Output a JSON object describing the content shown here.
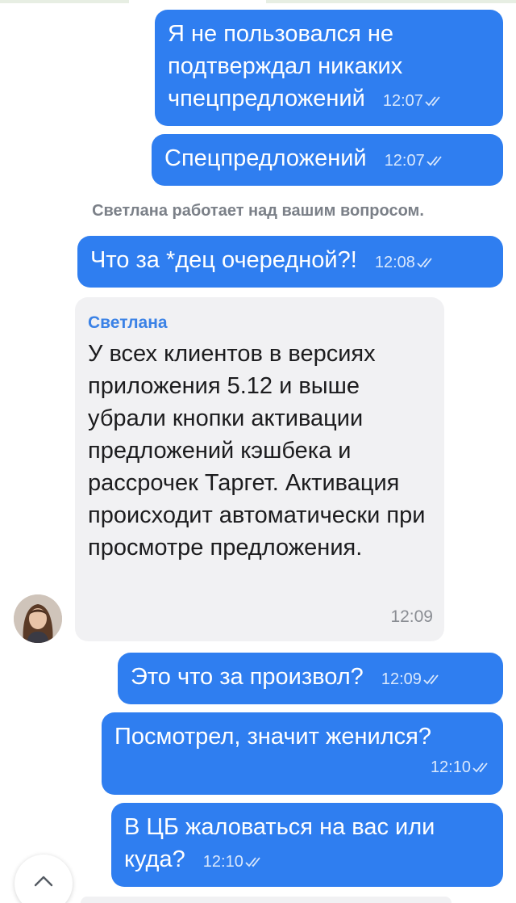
{
  "messages": [
    {
      "text": "Я не пользовался не подтверждал никаких чпецпредложений",
      "time": "12:07"
    },
    {
      "text": "Спецпредложений",
      "time": "12:07"
    },
    {
      "text": "Что за *дец очередной?!",
      "time": "12:08"
    },
    {
      "sender": "Светлана",
      "text": "У всех клиентов в версиях приложения 5.12 и выше убрали кнопки активации предложений кэшбека и рассрочек Таргет. Активация происходит автоматически при просмотре предложения.",
      "time": "12:09"
    },
    {
      "text": "Это что за произвол?",
      "time": "12:09"
    },
    {
      "text": "Посмотрел, значит женился?",
      "time": "12:10"
    },
    {
      "text": "В ЦБ жаловаться на вас или куда?",
      "time": "12:10"
    }
  ],
  "system_note": "Светлана работает над вашим вопросом.",
  "colors": {
    "outgoing": "#2f7ef0",
    "incoming": "#f1f1f3",
    "sender_name": "#3b82e6"
  },
  "icons": {
    "read_receipt": "double-check-icon",
    "scroll_up": "chevron-up-icon"
  }
}
